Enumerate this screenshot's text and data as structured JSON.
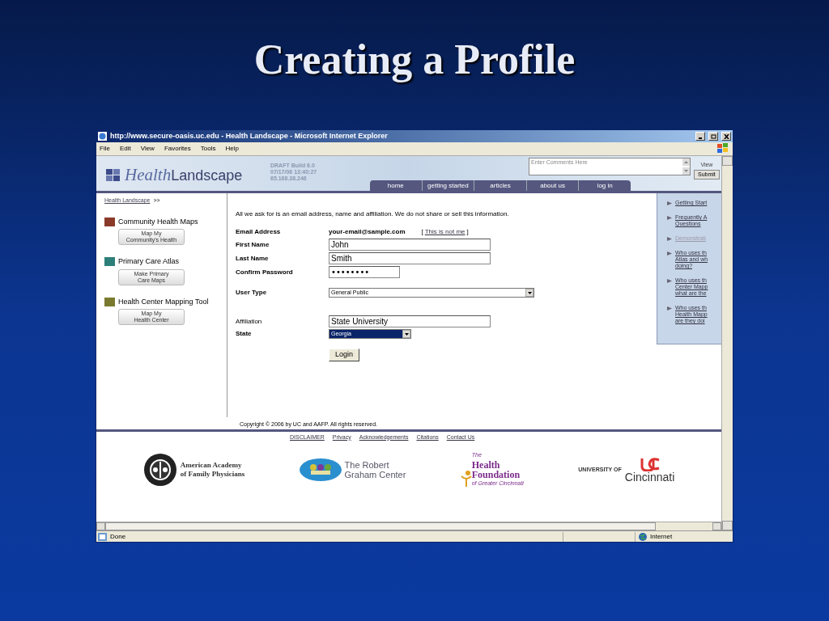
{
  "slide": {
    "title": "Creating a Profile"
  },
  "window": {
    "title": "http://www.secure-oasis.uc.edu - Health Landscape - Microsoft Internet Explorer"
  },
  "menu": [
    "File",
    "Edit",
    "View",
    "Favorites",
    "Tools",
    "Help"
  ],
  "site": {
    "logo_italic": "Health",
    "logo_plain": "Landscape",
    "build": "DRAFT Build 6.0\n07/17/06  13:40:27\n65.168.38.246",
    "comments": {
      "placeholder": "Enter Comments Here"
    },
    "view": "View",
    "submit": "Submit",
    "tabs": [
      "home",
      "getting started",
      "articles",
      "about us",
      "log in"
    ]
  },
  "breadcrumb": "Health Landscape",
  "breadcrumb_sep": ">>",
  "tools": [
    {
      "title": "Community Health Maps",
      "button": "Map My\nCommunity's Health",
      "color": "#8b3a2a"
    },
    {
      "title": "Primary Care Atlas",
      "button": "Make Primary\nCare Maps",
      "color": "#2e7f7a"
    },
    {
      "title": "Health Center Mapping Tool",
      "button": "Map My\nHealth Center",
      "color": "#7a7a2e"
    }
  ],
  "form": {
    "intro": "All we ask for is an email address, name and affiliation. We do not share or sell this information.",
    "rows": [
      {
        "kind": "static",
        "label": "Email Address",
        "emphasis": true,
        "value": "your-email@sample.com",
        "link_open": "[",
        "link": "This is not me",
        "link_close": "]"
      },
      {
        "kind": "text",
        "label": "First Name",
        "emphasis": true,
        "value": "John"
      },
      {
        "kind": "text",
        "label": "Last Name",
        "emphasis": true,
        "value": "Smith"
      },
      {
        "kind": "password",
        "label": "Confirm Password",
        "emphasis": true,
        "value": "••••••••"
      },
      {
        "kind": "select",
        "label": "User Type",
        "emphasis": true,
        "value": "General Public",
        "focused": false
      },
      {
        "kind": "text",
        "label": "Affiliation",
        "emphasis": false,
        "value": "State University"
      },
      {
        "kind": "select",
        "label": "State",
        "emphasis": true,
        "value": "Georgia",
        "focused": true
      }
    ],
    "button": "Login"
  },
  "help_links": [
    {
      "label": "Getting Start",
      "disabled": false
    },
    {
      "label": "Frequently A\nQuestions",
      "disabled": false
    },
    {
      "label": "Demonstrati",
      "disabled": true
    },
    {
      "label": "Who uses th\nAtlas and wh\ndoing?",
      "disabled": false
    },
    {
      "label": "Who uses th\nCenter Mapp\nwhat are the",
      "disabled": false
    },
    {
      "label": "Who uses th\nHealth Mapp\nare they doi",
      "disabled": false
    }
  ],
  "footer": {
    "copyright": "Copyright © 2006 by UC and AAFP. All rights reserved.",
    "links": [
      "DISCLAIMER",
      "Privacy",
      "Acknowledgements",
      "Citations",
      "Contact Us"
    ],
    "partners": [
      {
        "kind": "aafp",
        "name": "American Academy\nof Family Physicians"
      },
      {
        "kind": "rgc",
        "name": "The Robert\nGraham Center"
      },
      {
        "kind": "hf",
        "top": "The",
        "name": "Health\nFoundation",
        "sub": "of Greater Cincinnati"
      },
      {
        "kind": "uc",
        "top": "UNIVERSITY OF",
        "name": "Cincinnati"
      }
    ]
  },
  "status": {
    "text": "Done",
    "zone": "Internet"
  }
}
